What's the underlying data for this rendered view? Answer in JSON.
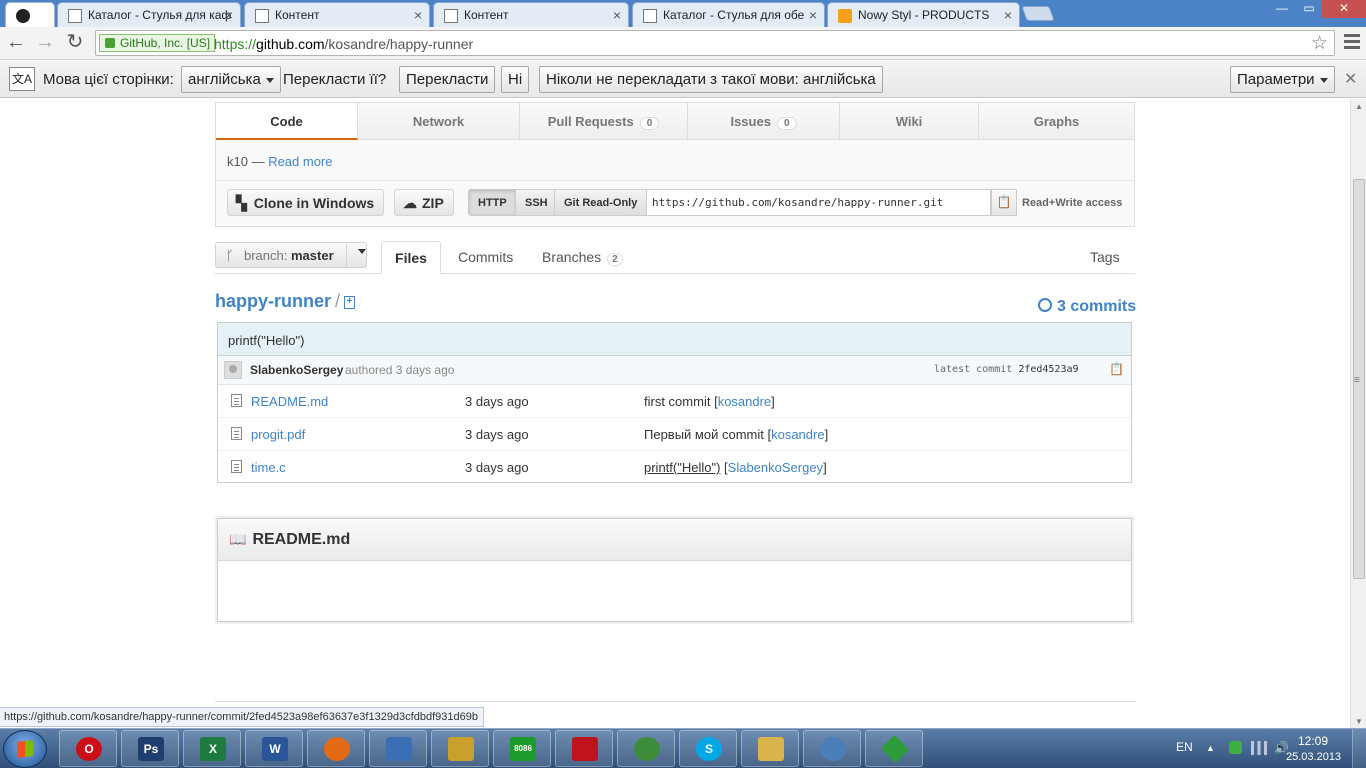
{
  "browser": {
    "tabs": [
      {
        "title": "",
        "favicon": "github-icon",
        "active": true
      },
      {
        "title": "Каталог - Стулья для каф",
        "favicon": "page-icon"
      },
      {
        "title": "Контент",
        "favicon": "page-icon"
      },
      {
        "title": "Контент",
        "favicon": "page-icon"
      },
      {
        "title": "Каталог - Стулья для обе",
        "favicon": "page-icon"
      },
      {
        "title": "Nowy Styl - PRODUCTS",
        "favicon": "ns-icon"
      }
    ],
    "window_controls": {
      "minimize": "—",
      "maximize": "▭",
      "close": "✕"
    },
    "ev_badge": "GitHub, Inc. [US]",
    "url_scheme": "https://",
    "url_host": "github.com",
    "url_path": "/kosandre/happy-runner"
  },
  "translate_bar": {
    "page_language_label": "Мова цієї сторінки:",
    "language_select": "англійська",
    "question": "Перекласти її?",
    "translate_button": "Перекласти",
    "no_button": "Ні",
    "never_button": "Ніколи не перекладати з такої мови: англійська",
    "options_button": "Параметри"
  },
  "repo_nav": {
    "code": "Code",
    "network": "Network",
    "pull_requests": "Pull Requests",
    "pull_requests_count": "0",
    "issues": "Issues",
    "issues_count": "0",
    "wiki": "Wiki",
    "graphs": "Graphs"
  },
  "repo_desc": {
    "text": "k10 — ",
    "read_more": "Read more"
  },
  "clone": {
    "clone_windows": "Clone in Windows",
    "zip": "ZIP",
    "http": "HTTP",
    "ssh": "SSH",
    "git_readonly": "Git Read-Only",
    "url": "https://github.com/kosandre/happy-runner.git",
    "access": "Read+Write access"
  },
  "branch": {
    "label": "branch:",
    "name": "master"
  },
  "subnav": {
    "files": "Files",
    "commits": "Commits",
    "branches": "Branches",
    "branches_count": "2",
    "tags": "Tags"
  },
  "breadcrumb": {
    "repo": "happy-runner",
    "separator": "/"
  },
  "commits_link": "3 commits",
  "last_commit": {
    "message": "printf(\"Hello\")",
    "author": "SlabenkoSergey",
    "when": "authored 3 days ago",
    "latest_label": "latest commit",
    "sha": "2fed4523a9"
  },
  "files": [
    {
      "name": "README.md",
      "age": "3 days ago",
      "message": "first commit",
      "author": "kosandre",
      "message_linked": false
    },
    {
      "name": "progit.pdf",
      "age": "3 days ago",
      "message": "Первый мой commit",
      "author": "kosandre",
      "message_linked": false
    },
    {
      "name": "time.c",
      "age": "3 days ago",
      "message": "printf(\"Hello\")",
      "author": "SlabenkoSergey",
      "message_linked": true
    }
  ],
  "readme": {
    "title": "README.md"
  },
  "status_url": "https://github.com/kosandre/happy-runner/commit/2fed4523a98ef63637e3f1329d3cfdbdf931d69b",
  "taskbar": {
    "apps": [
      {
        "name": "opera",
        "icon": "opera-icon",
        "label": "O",
        "color": "#cc0f16"
      },
      {
        "name": "photoshop",
        "icon": "photoshop-icon",
        "label": "Ps",
        "color": "#1d3e6e"
      },
      {
        "name": "excel",
        "icon": "excel-icon",
        "label": "X",
        "color": "#1f7a3f"
      },
      {
        "name": "word",
        "icon": "word-icon",
        "label": "W",
        "color": "#2a5699"
      },
      {
        "name": "firefox",
        "icon": "firefox-icon",
        "label": "",
        "color": "#e36b17"
      },
      {
        "name": "app-blue",
        "icon": "app-icon",
        "label": "",
        "color": "#3a6fb5"
      },
      {
        "name": "winamp",
        "icon": "lightning-icon",
        "label": "",
        "color": "#c7a12c"
      },
      {
        "name": "emu8086",
        "icon": "chip-icon",
        "label": "8086",
        "color": "#1c9a2d"
      },
      {
        "name": "acrobat",
        "icon": "pdf-icon",
        "label": "",
        "color": "#c0141c"
      },
      {
        "name": "chrome",
        "icon": "chrome-icon",
        "label": "",
        "color": "#3d8c3a"
      },
      {
        "name": "skype",
        "icon": "skype-icon",
        "label": "S",
        "color": "#00a8e8"
      },
      {
        "name": "explorer",
        "icon": "folder-icon",
        "label": "",
        "color": "#d9b44a"
      },
      {
        "name": "app-cat",
        "icon": "cat-icon",
        "label": "",
        "color": "#4a7fb8"
      },
      {
        "name": "app-diamond",
        "icon": "diamond-icon",
        "label": "",
        "color": "#2e9b3a"
      }
    ],
    "language": "EN",
    "time": "12:09",
    "date": "25.03.2013"
  },
  "colors": {
    "link": "#4183c4",
    "active_tab_accent": "#d26911",
    "ev_green": "#2b7a1e"
  }
}
